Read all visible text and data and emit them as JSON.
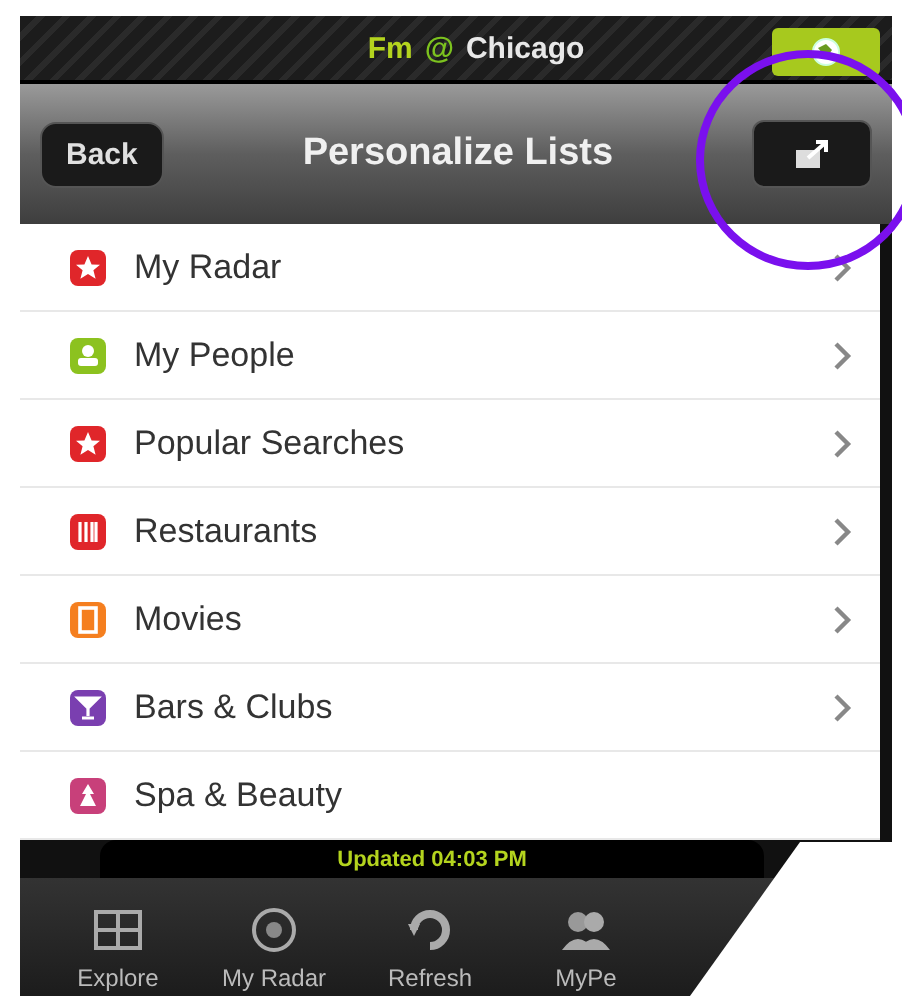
{
  "status_bar": {
    "prefix": "Fm",
    "at": "@",
    "city": "Chicago"
  },
  "nav_bar": {
    "back": "Back",
    "title": "Personalize Lists"
  },
  "lists": [
    {
      "label": "My Radar",
      "color": "#e0262a",
      "chevron": true
    },
    {
      "label": "My People",
      "color": "#8cc21f",
      "chevron": true
    },
    {
      "label": "Popular Searches",
      "color": "#e0262a",
      "chevron": true
    },
    {
      "label": "Restaurants",
      "color": "#e0262a",
      "chevron": true
    },
    {
      "label": "Movies",
      "color": "#f57f1f",
      "chevron": true
    },
    {
      "label": "Bars & Clubs",
      "color": "#7a3fb0",
      "chevron": true
    },
    {
      "label": "Spa & Beauty",
      "color": "#c8407a",
      "chevron": false
    }
  ],
  "update_banner": "Updated 04:03 PM",
  "tab_bar": [
    {
      "label": "Explore",
      "selected": false
    },
    {
      "label": "My Radar",
      "selected": false
    },
    {
      "label": "Refresh",
      "selected": false
    },
    {
      "label": "MyPe",
      "selected": false
    }
  ],
  "annotation": {
    "kind": "circle"
  }
}
